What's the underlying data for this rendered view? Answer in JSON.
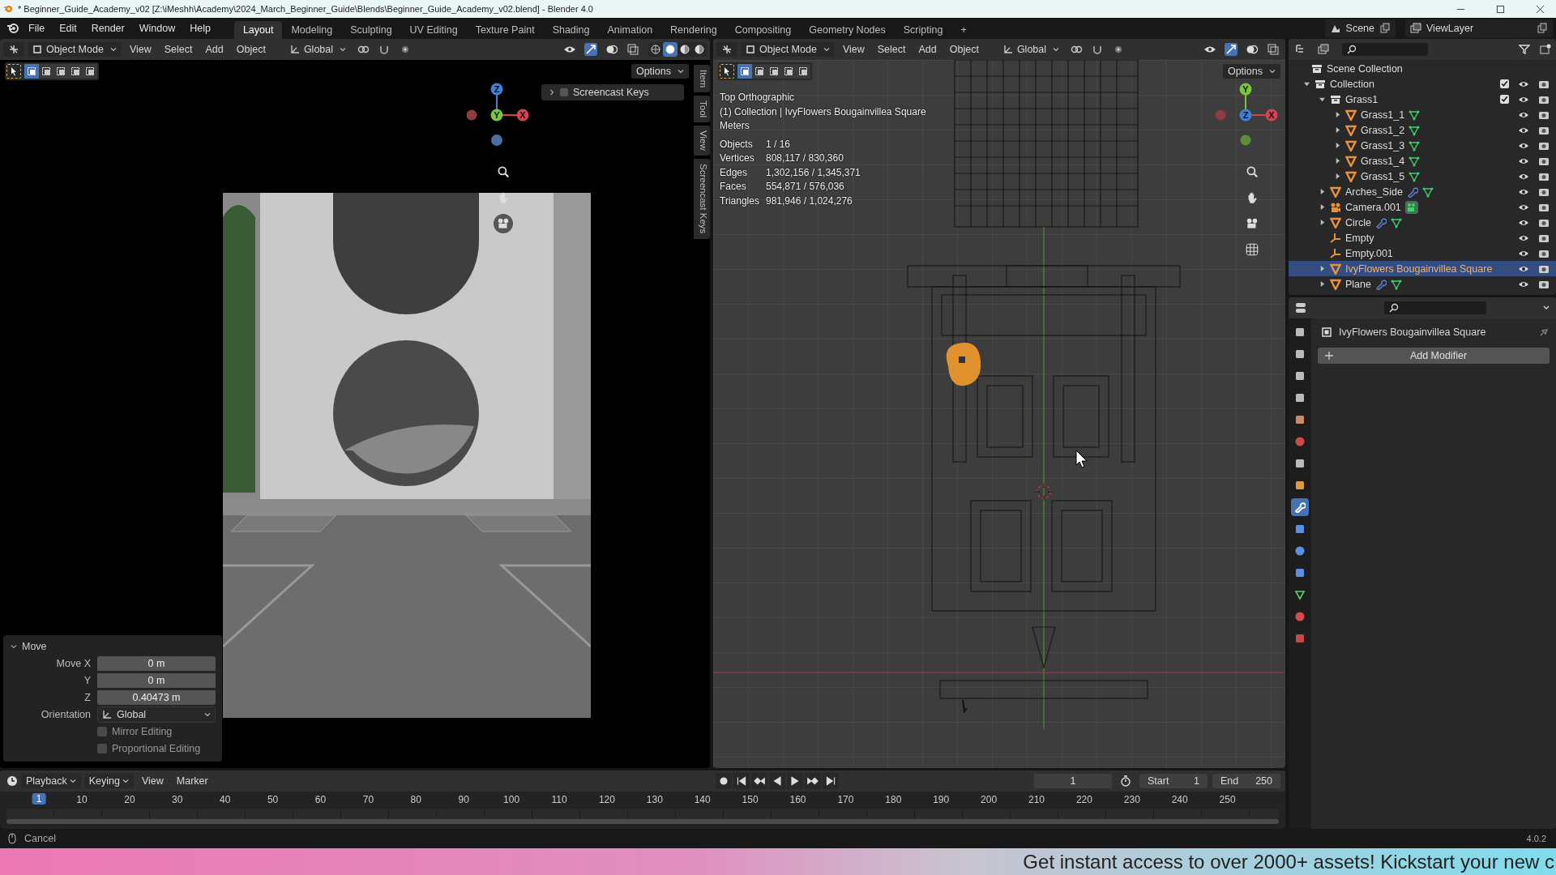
{
  "window": {
    "title": "* Beginner_Guide_Academy_v02 [Z:\\iMeshh\\Academy\\2024_March_Beginner_Guide\\Blends\\Beginner_Guide_Academy_v02.blend] - Blender 4.0"
  },
  "menu": [
    "File",
    "Edit",
    "Render",
    "Window",
    "Help"
  ],
  "workspaces": [
    {
      "label": "Layout",
      "selected": true
    },
    {
      "label": "Modeling",
      "selected": false
    },
    {
      "label": "Sculpting",
      "selected": false
    },
    {
      "label": "UV Editing",
      "selected": false
    },
    {
      "label": "Texture Paint",
      "selected": false
    },
    {
      "label": "Shading",
      "selected": false
    },
    {
      "label": "Animation",
      "selected": false
    },
    {
      "label": "Rendering",
      "selected": false
    },
    {
      "label": "Compositing",
      "selected": false
    },
    {
      "label": "Geometry Nodes",
      "selected": false
    },
    {
      "label": "Scripting",
      "selected": false
    }
  ],
  "add_workspace": "+",
  "scene": "Scene",
  "view_layer": "ViewLayer",
  "viewports": [
    {
      "mode": "Object Mode",
      "menus": [
        "View",
        "Select",
        "Add",
        "Object"
      ],
      "orientation": "Global",
      "options": "Options",
      "select_modes": [
        {
          "selected": true
        },
        {
          "selected": false
        },
        {
          "selected": false
        },
        {
          "selected": false
        },
        {
          "selected": false
        }
      ],
      "shading": [
        {
          "kind": "wireframe",
          "selected": false
        },
        {
          "kind": "solid",
          "selected": true
        },
        {
          "kind": "material",
          "selected": false
        },
        {
          "kind": "rendered",
          "selected": false
        }
      ]
    },
    {
      "mode": "Object Mode",
      "menus": [
        "View",
        "Select",
        "Add",
        "Object"
      ],
      "orientation": "Global",
      "options": "Options",
      "select_modes": [
        {
          "selected": true
        },
        {
          "selected": false
        },
        {
          "selected": false
        },
        {
          "selected": false
        },
        {
          "selected": false
        }
      ]
    }
  ],
  "left_viewport": {
    "gizmo": [
      {
        "kind": "z",
        "label": "Z"
      },
      {
        "kind": "y",
        "label": "Y"
      },
      {
        "kind": "x",
        "label": "X"
      }
    ],
    "panel": "Screencast Keys",
    "panel_checked": false,
    "side_tabs": [
      "Item",
      "Tool",
      "View",
      "Screencast Keys"
    ]
  },
  "operator_panel": {
    "title": "Move",
    "fields": [
      {
        "label": "Move X",
        "value": "0 m"
      },
      {
        "label": "Y",
        "value": "0 m"
      },
      {
        "label": "Z",
        "value": "0.40473 m"
      }
    ],
    "orientation_label": "Orientation",
    "orientation": "Global",
    "checkboxes": [
      {
        "label": "Mirror Editing",
        "checked": false
      },
      {
        "label": "Proportional Editing",
        "checked": false
      }
    ]
  },
  "right_viewport": {
    "gizmo": [
      {
        "kind": "y",
        "label": "Y"
      },
      {
        "kind": "z",
        "label": "Z"
      },
      {
        "kind": "x",
        "label": "X"
      }
    ],
    "overlay": [
      "Top Orthographic",
      "(1) Collection | IvyFlowers Bougainvillea Square",
      "Meters"
    ],
    "stats": [
      {
        "label": "Objects",
        "value": "1 / 16"
      },
      {
        "label": "Vertices",
        "value": "808,117 / 830,360"
      },
      {
        "label": "Edges",
        "value": "1,302,156 / 1,345,371"
      },
      {
        "label": "Faces",
        "value": "554,871 / 576,036"
      },
      {
        "label": "Triangles",
        "value": "981,946 / 1,024,276"
      }
    ]
  },
  "outliner": {
    "root": "Scene Collection",
    "items": [
      {
        "name": "Collection",
        "kind": "collection",
        "expanded": true,
        "checked": true,
        "selected": false,
        "children": [
          {
            "name": "Grass1",
            "kind": "collection",
            "expanded": true,
            "checked": true,
            "selected": false,
            "children": [
              {
                "name": "Grass1_1",
                "kind": "mesh",
                "expanded": false,
                "modifiers": false,
                "data": true,
                "selected": false
              },
              {
                "name": "Grass1_2",
                "kind": "mesh",
                "expanded": false,
                "modifiers": false,
                "data": true,
                "selected": false
              },
              {
                "name": "Grass1_3",
                "kind": "mesh",
                "expanded": false,
                "modifiers": false,
                "data": true,
                "selected": false
              },
              {
                "name": "Grass1_4",
                "kind": "mesh",
                "expanded": false,
                "modifiers": false,
                "data": true,
                "selected": false
              },
              {
                "name": "Grass1_5",
                "kind": "mesh",
                "expanded": false,
                "modifiers": false,
                "data": true,
                "selected": false
              }
            ]
          },
          {
            "name": "Arches_Side",
            "kind": "mesh",
            "expanded": false,
            "modifiers": true,
            "data": true,
            "selected": false
          },
          {
            "name": "Camera.001",
            "kind": "camera",
            "expanded": false,
            "modifiers": false,
            "data": true,
            "selected": false
          },
          {
            "name": "Circle",
            "kind": "mesh",
            "expanded": false,
            "modifiers": true,
            "data": true,
            "selected": false
          },
          {
            "name": "Empty",
            "kind": "empty",
            "selected": false
          },
          {
            "name": "Empty.001",
            "kind": "empty",
            "selected": false
          },
          {
            "name": "IvyFlowers Bougainvillea Square",
            "kind": "mesh",
            "expanded": false,
            "modifiers": false,
            "data": false,
            "selected": true
          },
          {
            "name": "Plane",
            "kind": "mesh",
            "expanded": false,
            "modifiers": true,
            "data": true,
            "selected": false
          }
        ]
      }
    ]
  },
  "properties": {
    "tabs": [
      {
        "kind": "tool",
        "selected": false
      },
      {
        "kind": "render",
        "selected": false
      },
      {
        "kind": "output",
        "selected": false
      },
      {
        "kind": "view_layer",
        "selected": false
      },
      {
        "kind": "scene",
        "selected": false
      },
      {
        "kind": "world",
        "selected": false
      },
      {
        "kind": "collection",
        "selected": false
      },
      {
        "kind": "object",
        "selected": false
      },
      {
        "kind": "modifier",
        "selected": true
      },
      {
        "kind": "particles",
        "selected": false
      },
      {
        "kind": "physics",
        "selected": false
      },
      {
        "kind": "constraints",
        "selected": false
      },
      {
        "kind": "data",
        "selected": false
      },
      {
        "kind": "material",
        "selected": false
      },
      {
        "kind": "texture",
        "selected": false
      }
    ],
    "object": "IvyFlowers Bougainvillea Square",
    "add_modifier": "Add Modifier"
  },
  "timeline": {
    "menus": [
      "Playback",
      "Keying",
      "View",
      "Marker"
    ],
    "current_frame": "1",
    "start_label": "Start",
    "start": "1",
    "end_label": "End",
    "end": "250",
    "playhead": "1",
    "ruler": [
      "10",
      "20",
      "30",
      "40",
      "50",
      "60",
      "70",
      "80",
      "90",
      "100",
      "110",
      "120",
      "130",
      "140",
      "150",
      "160",
      "170",
      "180",
      "190",
      "200",
      "210",
      "220",
      "230",
      "240",
      "250"
    ]
  },
  "status": {
    "hint": "Cancel",
    "version": "4.0.2"
  },
  "banner": "Get instant access to over 2000+ assets! Kickstart your new c"
}
